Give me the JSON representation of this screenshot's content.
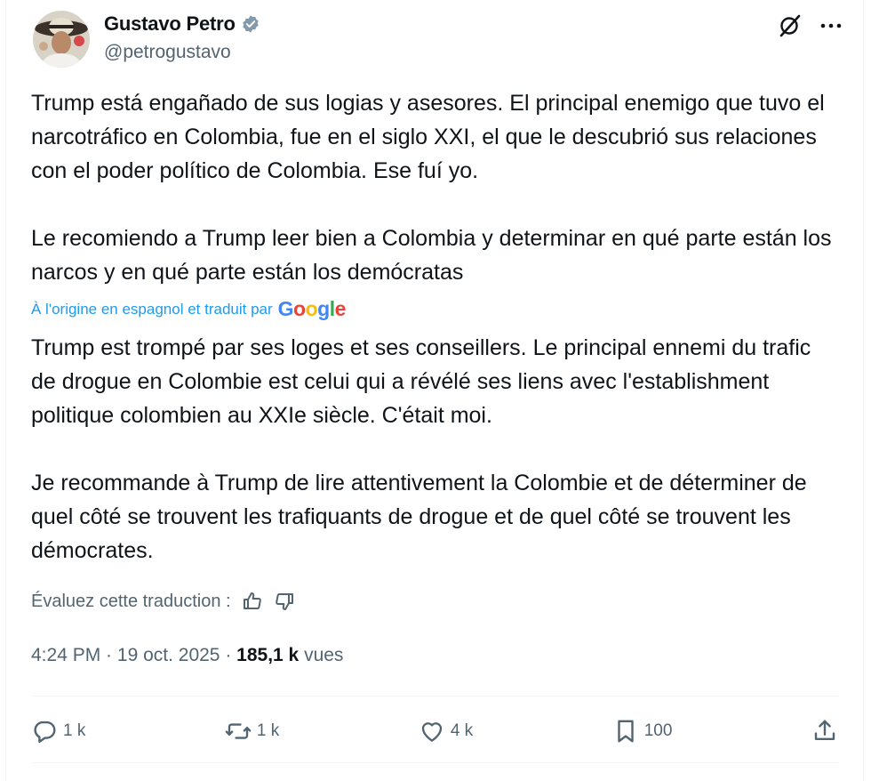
{
  "author": {
    "name": "Gustavo Petro",
    "handle": "@petrogustavo"
  },
  "tweet": {
    "text": "Trump está engañado de sus logias y asesores. El principal enemigo que tuvo el narcotráfico en Colombia, fue en el siglo XXI, el que le descubrió sus relaciones con el poder político de Colombia. Ese fuí yo.\n\nLe recomiendo a Trump leer bien a Colombia y determinar en qué parte están los narcos y en qué parte están los demócratas",
    "translated_label": "À l'origine en espagnol et traduit par",
    "translated_by": "Google",
    "translation": "Trump est trompé par ses loges et ses conseillers. Le principal ennemi du trafic de drogue en Colombie est celui qui a révélé ses liens avec l'establishment politique colombien au XXIe siècle. C'était moi.\n\nJe recommande à Trump de lire attentivement la Colombie et de déterminer de quel côté se trouvent les trafiquants de drogue et de quel côté se trouvent les démocrates.",
    "rate_label": "Évaluez cette traduction :"
  },
  "meta": {
    "time": "4:24 PM",
    "separator": " · ",
    "date": "19 oct. 2025",
    "views_count": "185,1 k",
    "views_label": " vues"
  },
  "actions": {
    "replies": "1 k",
    "reposts": "1 k",
    "likes": "4 k",
    "bookmarks": "100"
  },
  "colors": {
    "link": "#1d9bf0",
    "muted": "#536471",
    "text": "#0f1419",
    "verified_badge": "#829aab"
  }
}
